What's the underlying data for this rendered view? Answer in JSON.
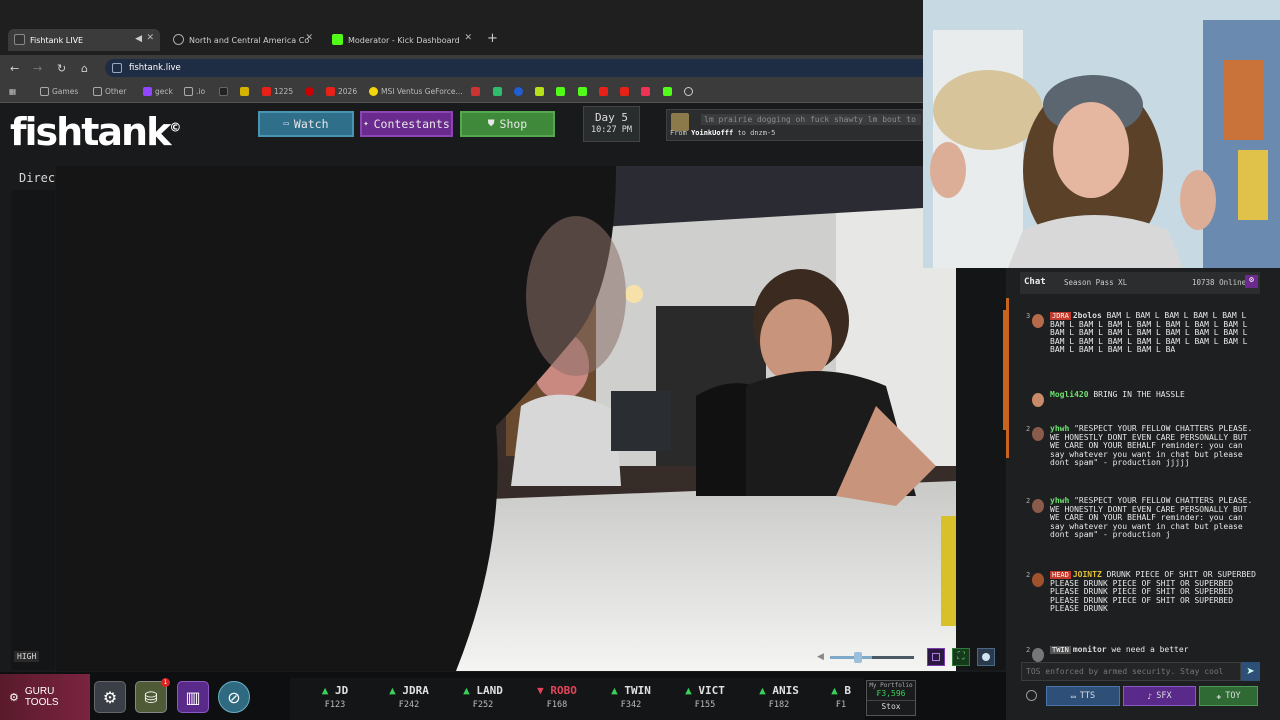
{
  "browser": {
    "tabs": [
      {
        "title": "Fishtank LIVE",
        "active": true
      },
      {
        "title": "North and Central America Co",
        "active": false
      },
      {
        "title": "Moderator - Kick Dashboard",
        "active": false
      }
    ],
    "new_tab": "+",
    "url": "fishtank.live",
    "bookmarks": [
      "Games",
      "Other",
      "geck",
      ".io",
      "1225",
      "2026",
      "MSI Ventus GeForce..."
    ]
  },
  "site": {
    "logo": "fishtank",
    "logo_mark": "©",
    "nav": {
      "watch": "Watch",
      "contestants": "Contestants",
      "shop": "Shop"
    },
    "day": {
      "label": "Day 5",
      "time": "10:27 PM"
    },
    "tts": {
      "text": "lm prairie dogging oh fuck shawty lm bout to",
      "from_label": "From",
      "from_user": "YoinkUofff",
      "to_label": "to",
      "to_target": "dnzm-5"
    },
    "director_mode": "Director Mode",
    "quality": "HIGH",
    "volume": 0.5
  },
  "tools": {
    "guru_label": "GURU TOOLS",
    "notif_count": "1"
  },
  "ticker": [
    {
      "name": "JD",
      "value": "₣123",
      "dir": "up"
    },
    {
      "name": "JDRA",
      "value": "₣242",
      "dir": "up"
    },
    {
      "name": "LAND",
      "value": "₣252",
      "dir": "up"
    },
    {
      "name": "ROBO",
      "value": "₣168",
      "dir": "down"
    },
    {
      "name": "TWIN",
      "value": "₣342",
      "dir": "up"
    },
    {
      "name": "VICT",
      "value": "₣155",
      "dir": "up"
    },
    {
      "name": "ANIS",
      "value": "₣182",
      "dir": "up"
    },
    {
      "name": "B",
      "value": "₣1",
      "dir": "up"
    }
  ],
  "portfolio": {
    "label": "My Portfolio",
    "value": "₣3,596",
    "stox": "Stox"
  },
  "chat": {
    "title": "Chat",
    "season_pass": "Season Pass XL",
    "online": "10738 Online",
    "messages": [
      {
        "rank": "3",
        "badge": "JDRA",
        "user": "2bolos",
        "text": "BAM L BAM L BAM L BAM L BAM L BAM L BAM L BAM L BAM L BAM L BAM L BAM L BAM L BAM L BAM L BAM L BAM L BAM L BAM L BAM L BAM L BAM L BAM L BAM L BAM L BAM L BAM L BAM L BAM L BAM L BA"
      },
      {
        "rank": "",
        "badge": "",
        "user": "Mogli420",
        "text": "BRING IN THE HASSLE"
      },
      {
        "rank": "2",
        "badge": "",
        "user": "yhwh",
        "text": "\"RESPECT YOUR FELLOW CHATTERS PLEASE. WE HONESTLY DONT EVEN CARE PERSONALLY BUT WE CARE ON YOUR BEHALF reminder: you can say whatever you want in chat but please dont spam\" - production jjjjj"
      },
      {
        "rank": "2",
        "badge": "",
        "user": "yhwh",
        "text": "\"RESPECT YOUR FELLOW CHATTERS PLEASE. WE HONESTLY DONT EVEN CARE PERSONALLY BUT WE CARE ON YOUR BEHALF reminder: you can say whatever you want in chat but please dont spam\" - production j"
      },
      {
        "rank": "2",
        "badge": "HEAD",
        "user": "JOINTZ",
        "text": "DRUNK PIECE OF SHIT OR SUPERBED PLEASE DRUNK PIECE OF SHIT OR SUPERBED PLEASE DRUNK PIECE OF SHIT OR SUPERBED PLEASE DRUNK PIECE OF SHIT OR SUPERBED PLEASE DRUNK"
      },
      {
        "rank": "2",
        "badge": "TWIN",
        "user": "monitor",
        "text": "we need a better"
      }
    ],
    "input_placeholder": "TOS enforced by armed security. Stay cool",
    "buttons": {
      "tts": "TTS",
      "sfx": "SFX",
      "toy": "TOY"
    }
  },
  "colors": {
    "watch": "#2f6f8a",
    "contestants": "#6a2a8e",
    "shop": "#3f8a3a",
    "up": "#3ad15a",
    "down": "#e0455a",
    "gold": "#e6c233"
  }
}
